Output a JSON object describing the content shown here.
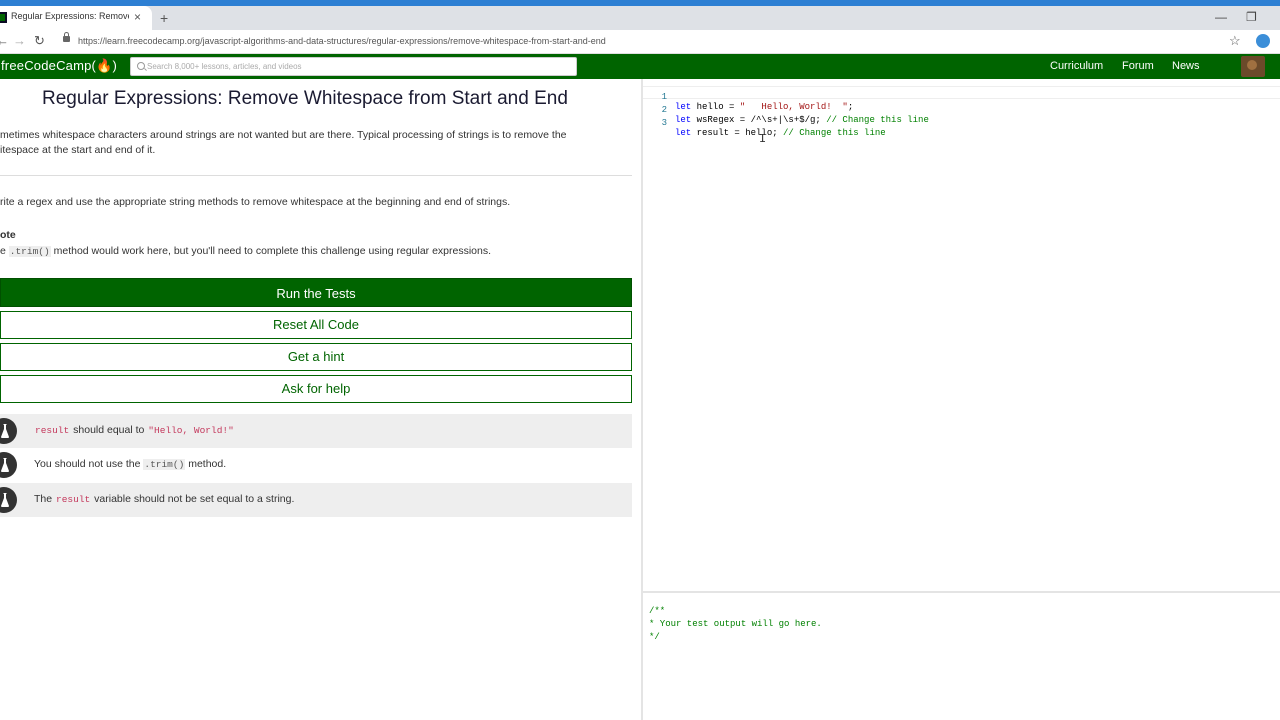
{
  "browser": {
    "tab_title": "Regular Expressions: Remove Whitespace from Start and End",
    "tab_close": "×",
    "new_tab": "+",
    "minimize": "—",
    "restore": "❐",
    "back": "←",
    "forward": "→",
    "reload": "↻",
    "url": "https://learn.freecodecamp.org/javascript-algorithms-and-data-structures/regular-expressions/remove-whitespace-from-start-and-end",
    "bookmark": "☆"
  },
  "nav": {
    "logo": "freeCodeCamp(🔥)",
    "search_placeholder": "Search 8,000+ lessons, articles, and videos",
    "links": [
      "Curriculum",
      "Forum",
      "News"
    ]
  },
  "challenge": {
    "title": "Regular Expressions: Remove Whitespace from Start and End",
    "intro_line1": "metimes whitespace characters around strings are not wanted but are there. Typical processing of strings is to remove the",
    "intro_line2": "itespace at the start and end of it.",
    "task": "rite a regex and use the appropriate string methods to remove whitespace at the beginning and end of strings.",
    "note_heading": "ote",
    "note_prefix": "e",
    "note_code": ".trim()",
    "note_suffix": "method would work here, but you'll need to complete this challenge using regular expressions."
  },
  "buttons": {
    "run": "Run the Tests",
    "reset": "Reset All Code",
    "hint": "Get a hint",
    "help": "Ask for help"
  },
  "tests": [
    {
      "code1": "result",
      "text1": "should equal to",
      "code2": "\"Hello, World!\""
    },
    {
      "text1": "You should not use the",
      "code1": ".trim()",
      "text2": "method."
    },
    {
      "text1": "The",
      "code1": "result",
      "text2": "variable should not be set equal to a string."
    }
  ],
  "editor": {
    "lines": [
      {
        "num": "1",
        "kw": "let",
        "rest": " hello = ",
        "str": "\"   Hello, World!  \"",
        "end": ";",
        "comment": ""
      },
      {
        "num": "2",
        "kw": "let",
        "rest": " wsRegex = /^\\s+|\\s+$/g; ",
        "str": "",
        "end": "",
        "comment": "// Change this line"
      },
      {
        "num": "3",
        "kw": "let",
        "rest": " result = hello; ",
        "str": "",
        "end": "",
        "comment": "// Change this line"
      }
    ],
    "cursor": "I"
  },
  "output": {
    "text": "/**\n* Your test output will go here.\n*/"
  },
  "colors": {
    "fcc_green": "#006400",
    "fcc_dark": "#1b1b32",
    "chrome_blue": "#2d7fd3"
  }
}
